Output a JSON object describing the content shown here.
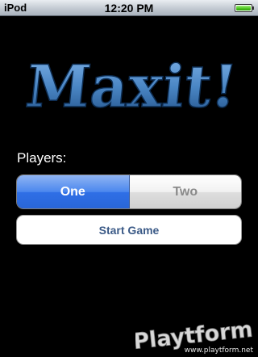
{
  "status_bar": {
    "carrier": "iPod",
    "time": "12:20 PM",
    "battery_level": 1.0
  },
  "logo": {
    "text": "Maxit!",
    "color": "#4a86c4"
  },
  "players": {
    "label": "Players:",
    "options": [
      "One",
      "Two"
    ],
    "selected": "One"
  },
  "start_button": {
    "label": "Start Game"
  },
  "watermark": {
    "brand": "Playtform",
    "url": "www.playtform.net"
  },
  "colors": {
    "selected_segment": "#3a7aea",
    "unselected_text": "#8a8a8a",
    "button_text": "#3b5a87"
  }
}
